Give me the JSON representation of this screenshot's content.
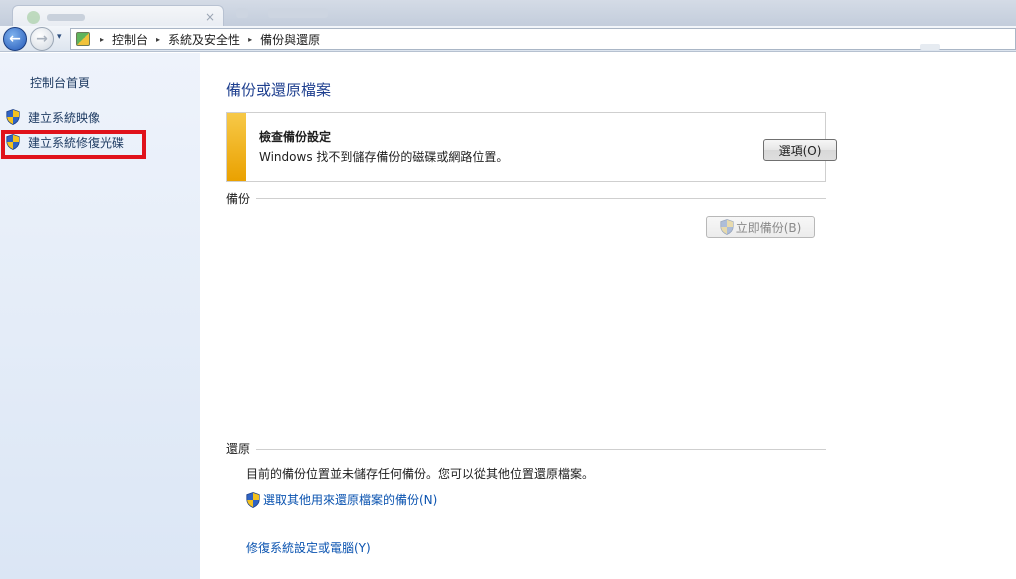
{
  "window": {
    "tab_close": "×"
  },
  "address_bar": {
    "crumbs": [
      "控制台",
      "系統及安全性",
      "備份與還原"
    ],
    "dropdown_glyph": "▾",
    "separator_glyph": "▸"
  },
  "nav": {
    "back_glyph": "←",
    "forward_glyph": "→"
  },
  "sidebar": {
    "home": "控制台首頁",
    "items": [
      {
        "label": "建立系統映像",
        "icon": "shield-icon"
      },
      {
        "label": "建立系統修復光碟",
        "icon": "shield-icon",
        "highlighted": true
      }
    ]
  },
  "main": {
    "title": "備份或還原檔案",
    "notice": {
      "title": "檢查備份設定",
      "text": "Windows 找不到儲存備份的磁碟或網路位置。",
      "button": "選項(O)"
    },
    "backup_section": {
      "label": "備份",
      "button": "立即備份(B)",
      "button_enabled": false
    },
    "restore_section": {
      "label": "還原",
      "text": "目前的備份位置並未儲存任何備份。您可以從其他位置還原檔案。",
      "link_select": "選取其他用來還原檔案的備份(N)",
      "link_recover": "修復系統設定或電腦(Y)"
    }
  },
  "colors": {
    "accent_title": "#1e3f8f",
    "link": "#0a53b0",
    "warning_bar": "#f2b820",
    "highlight_box": "#e0121b"
  }
}
